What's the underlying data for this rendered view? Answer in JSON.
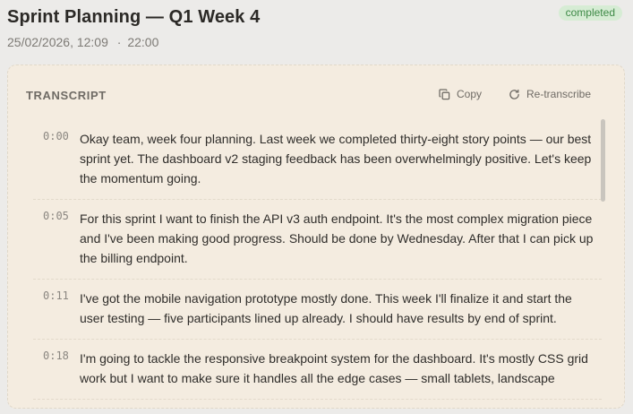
{
  "header": {
    "title": "Sprint Planning — Q1 Week 4",
    "date": "25/02/2026, 12:09",
    "separator": "·",
    "duration": "22:00",
    "status": "completed"
  },
  "transcript": {
    "heading": "TRANSCRIPT",
    "copy_label": "Copy",
    "retranscribe_label": "Re-transcribe",
    "segments": [
      {
        "time": "0:00",
        "text": "Okay team, week four planning. Last week we completed thirty-eight story points — our best sprint yet. The dashboard v2 staging feedback has been overwhelmingly positive. Let's keep the momentum going."
      },
      {
        "time": "0:05",
        "text": "For this sprint I want to finish the API v3 auth endpoint. It's the most complex migration piece and I've been making good progress. Should be done by Wednesday. After that I can pick up the billing endpoint."
      },
      {
        "time": "0:11",
        "text": "I've got the mobile navigation prototype mostly done. This week I'll finalize it and start the user testing — five participants lined up already. I should have results by end of sprint."
      },
      {
        "time": "0:18",
        "text": "I'm going to tackle the responsive breakpoint system for the dashboard. It's mostly CSS grid work but I want to make sure it handles all the edge cases — small tablets, landscape"
      }
    ]
  }
}
